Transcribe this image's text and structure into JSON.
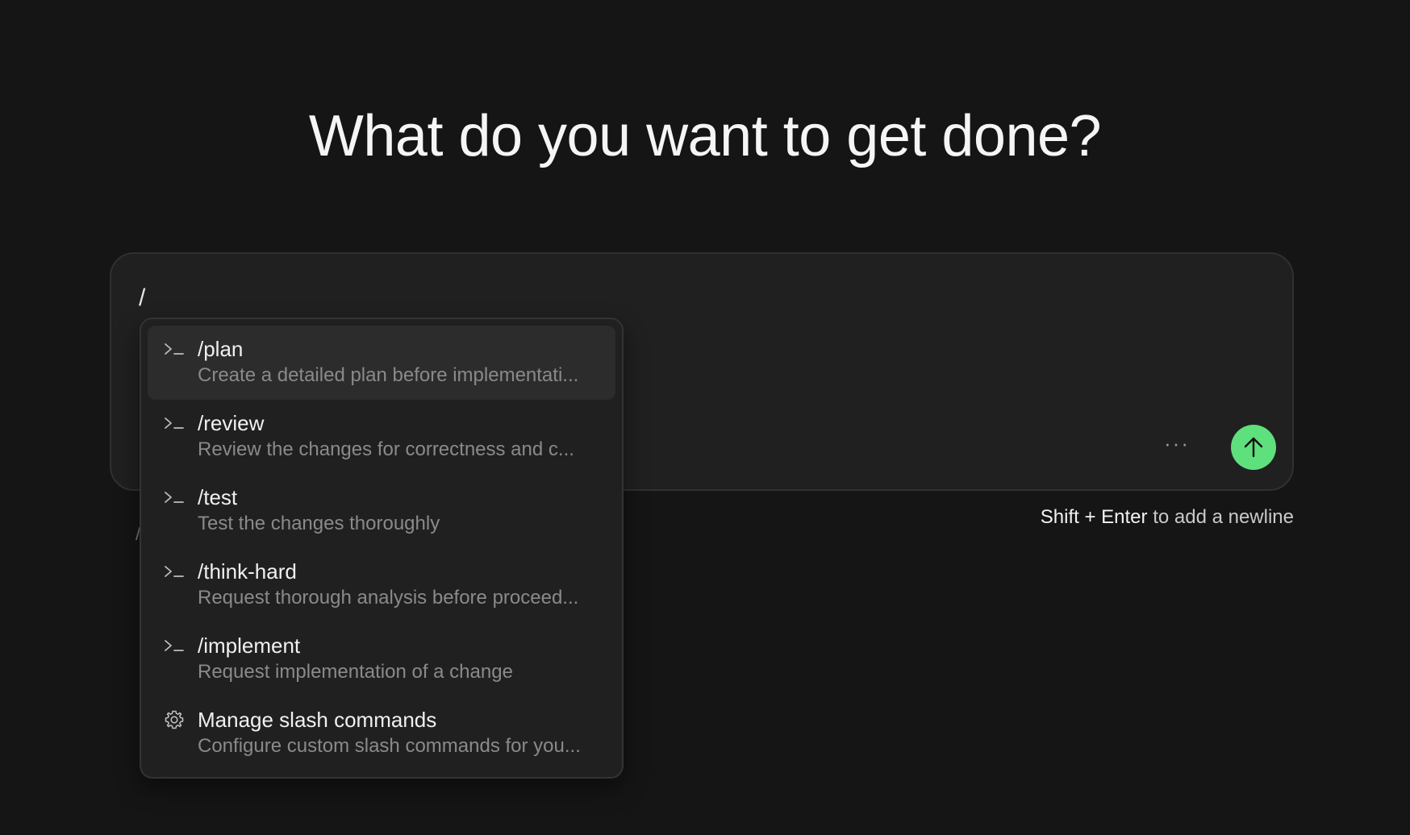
{
  "headline": "What do you want to get done?",
  "composer": {
    "input_value": "/",
    "more_label": "···"
  },
  "hint": {
    "key_combo": "Shift + Enter",
    "text": " to add a newline"
  },
  "behind_text": "/",
  "slash_menu": {
    "items": [
      {
        "title": "/plan",
        "description": "Create a detailed plan before implementati...",
        "icon": "terminal-icon",
        "selected": true
      },
      {
        "title": "/review",
        "description": "Review the changes for correctness and c...",
        "icon": "terminal-icon",
        "selected": false
      },
      {
        "title": "/test",
        "description": "Test the changes thoroughly",
        "icon": "terminal-icon",
        "selected": false
      },
      {
        "title": "/think-hard",
        "description": "Request thorough analysis before proceed...",
        "icon": "terminal-icon",
        "selected": false
      },
      {
        "title": "/implement",
        "description": "Request implementation of a change",
        "icon": "terminal-icon",
        "selected": false
      },
      {
        "title": "Manage slash commands",
        "description": "Configure custom slash commands for you...",
        "icon": "gear-icon",
        "selected": false
      }
    ]
  },
  "colors": {
    "background": "#151515",
    "panel": "#202020",
    "accent_green": "#5ee07d",
    "selected_row": "#2c2c2c"
  }
}
